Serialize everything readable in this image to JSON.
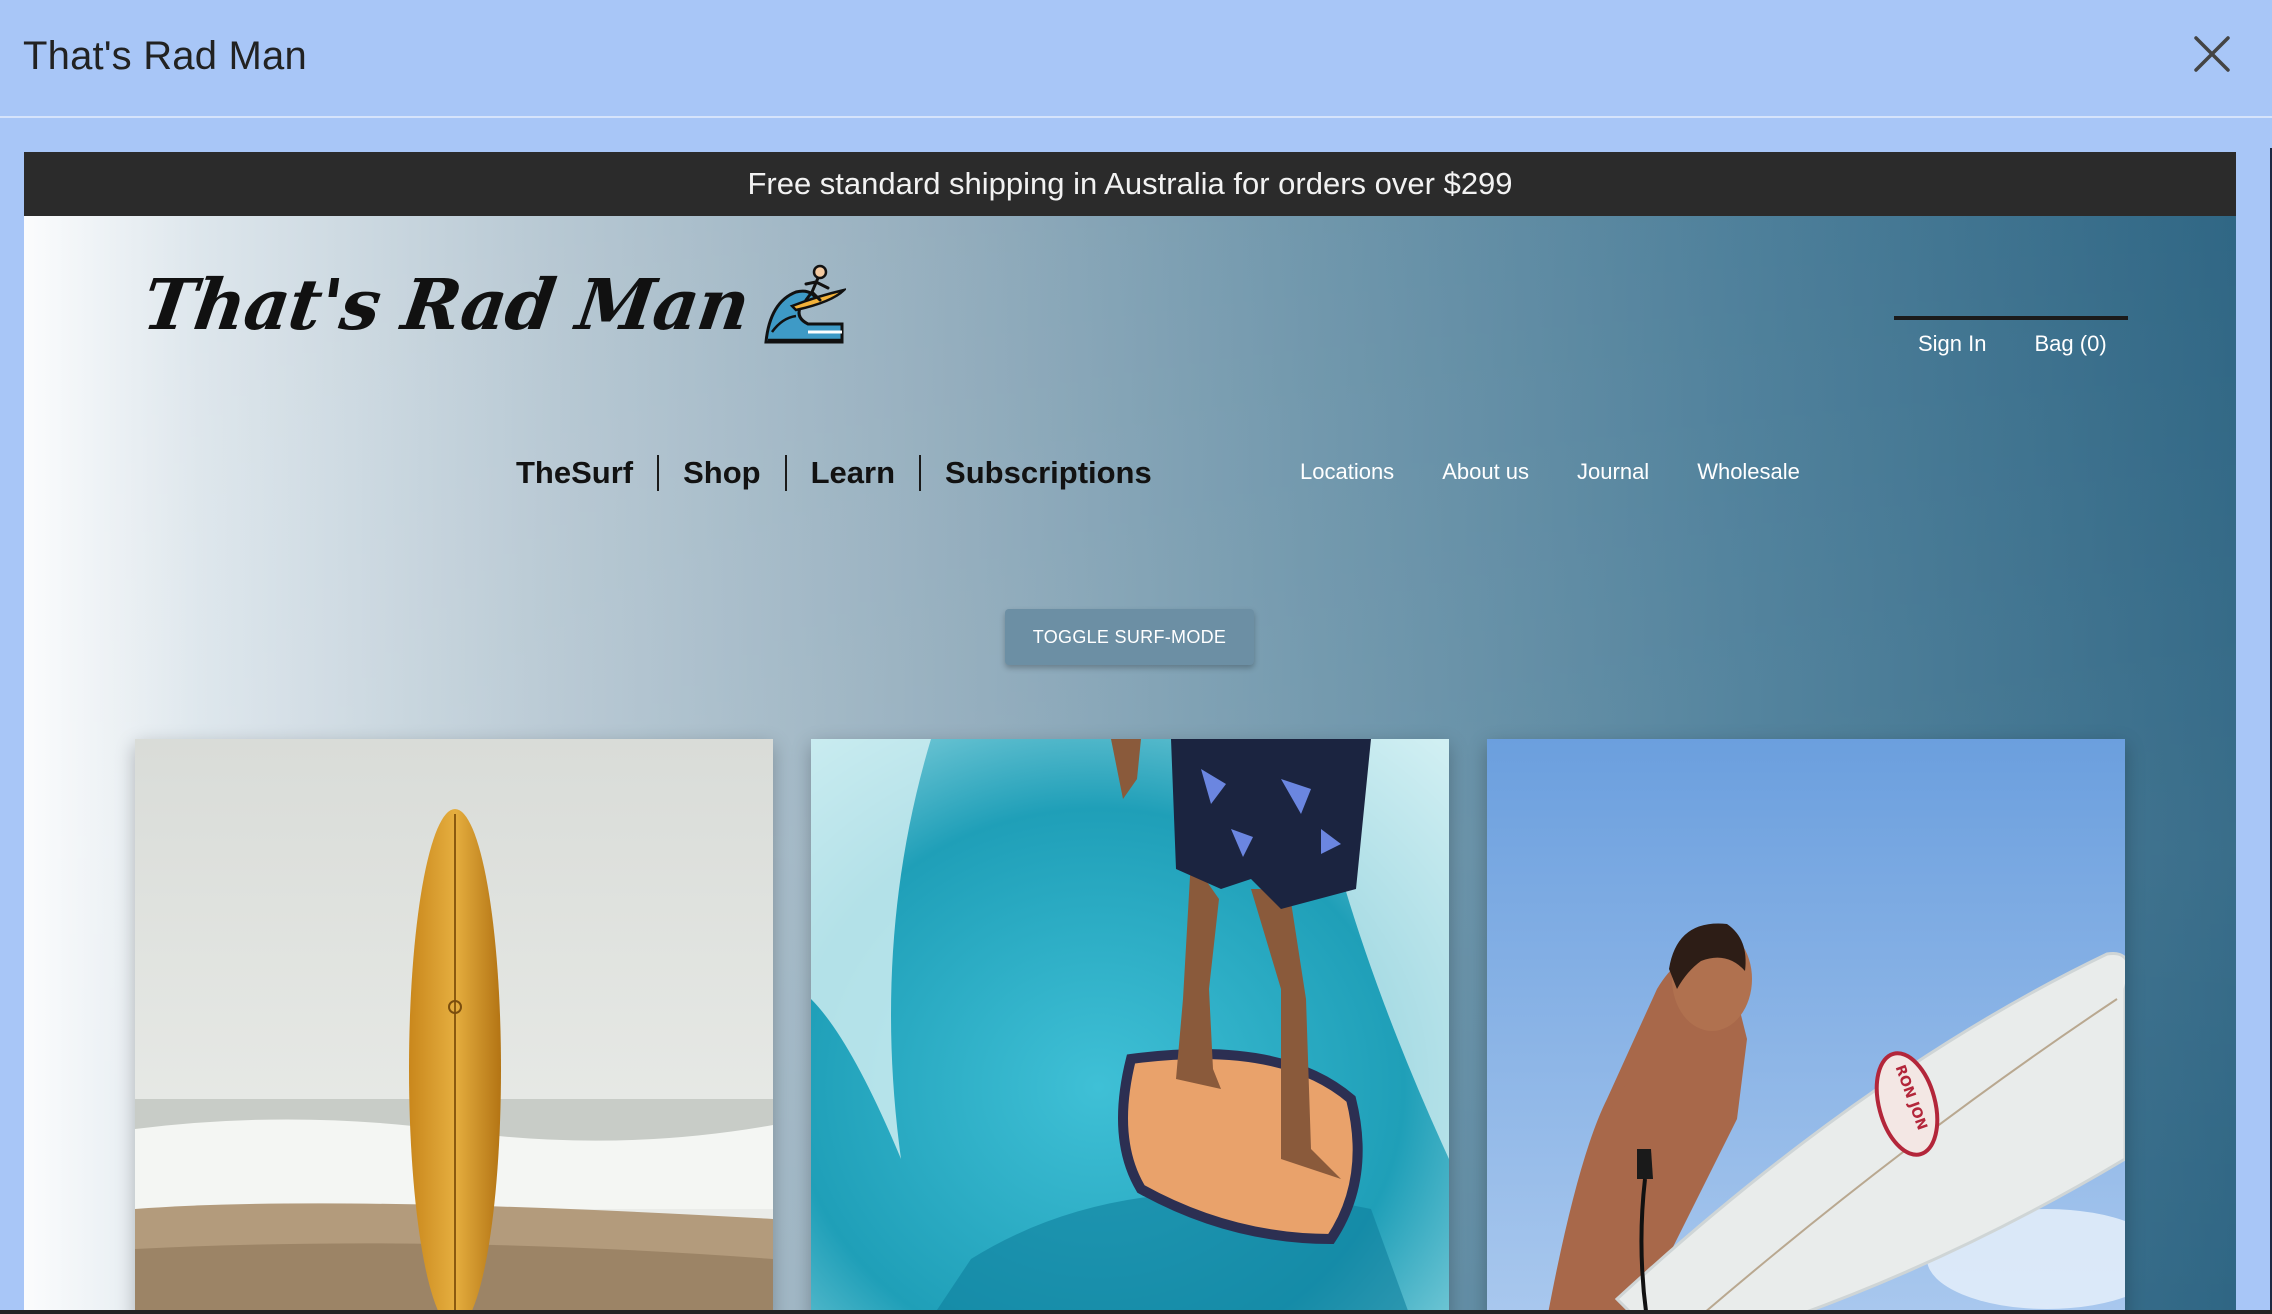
{
  "modal": {
    "title": "That's Rad Man",
    "close_icon": "close-icon"
  },
  "site": {
    "promo": "Free standard shipping in Australia for orders over $299",
    "logo": {
      "text": "That's Rad Man",
      "icon": "surfer-on-wave-icon"
    },
    "account": {
      "sign_in": "Sign In",
      "bag": "Bag (0)"
    },
    "main_nav": [
      "TheSurf",
      "Shop",
      "Learn",
      "Subscriptions"
    ],
    "secondary_nav": [
      "Locations",
      "About us",
      "Journal",
      "Wholesale"
    ],
    "toggle_button": "TOGGLE SURF-MODE",
    "cards": [
      {
        "image": "surfboard-on-beach"
      },
      {
        "image": "surfer-riding-wave"
      },
      {
        "image": "man-carrying-surfboard"
      }
    ]
  },
  "colors": {
    "modal_bg": "#a8c6f7",
    "promo_bg": "#2b2b2b",
    "button_bg": "#6c8fa4",
    "gradient_dark": "#2f6684"
  }
}
